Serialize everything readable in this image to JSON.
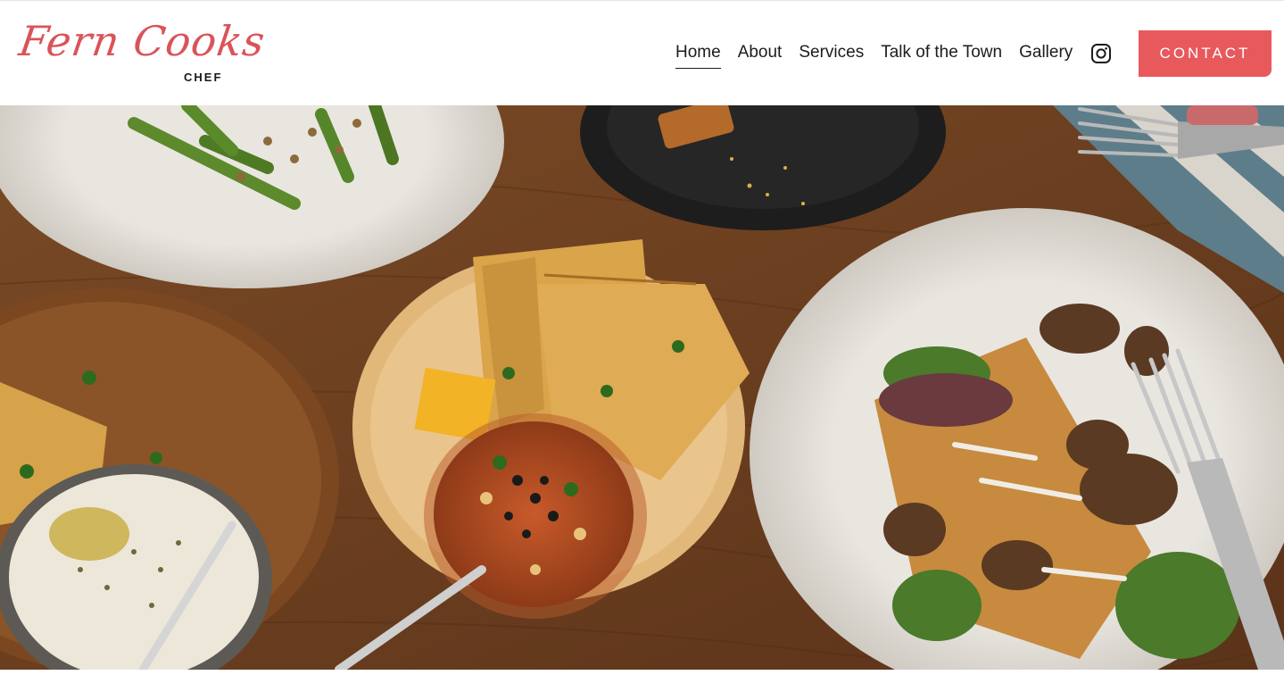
{
  "brand": {
    "logo_text": "Fern Cooks",
    "logo_subtitle": "CHEF",
    "accent_color": "#e8595c",
    "logo_color": "#d9545a"
  },
  "nav": {
    "items": [
      {
        "label": "Home",
        "active": true
      },
      {
        "label": "About",
        "active": false
      },
      {
        "label": "Services",
        "active": false
      },
      {
        "label": "Talk of the Town",
        "active": false
      },
      {
        "label": "Gallery",
        "active": false
      }
    ],
    "social_icon": "instagram-icon"
  },
  "cta": {
    "contact_label": "CONTACT"
  },
  "hero": {
    "image_subject": "overhead-food-spread"
  }
}
